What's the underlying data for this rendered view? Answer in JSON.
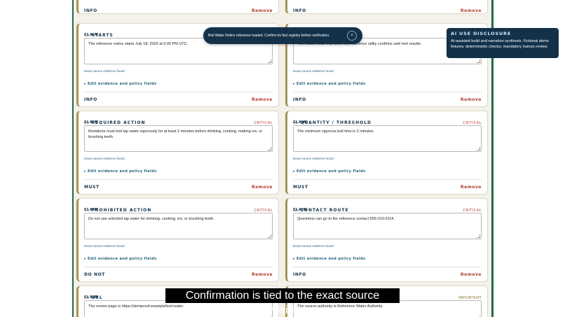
{
  "toast": {
    "message": "Boil Water Notice reference loaded. Confirm its fact registry before verification.",
    "close_label": "×"
  },
  "ai_disclosure": {
    "title": "AI USE DISCLOSURE",
    "body": "AI-assisted build and narration synthesis. Fictional demo fixtures; deterministic checks; mandatory human review."
  },
  "caption": "Confirmation is tied to the exact source revision.",
  "common": {
    "claim_label": "CLAIM",
    "evidence_text": "Exact source evidence found",
    "edit_label": "▸ Edit evidence and policy fields",
    "remove_label": "Remove"
  },
  "top_cards": [
    {
      "tag": "INFO"
    },
    {
      "tag": "INFO"
    }
  ],
  "cards": [
    {
      "number": "03",
      "title": "STARTS",
      "severity": "",
      "text": "The reference notice starts July 18, 2026 at 6:00 PM UTC.",
      "tag": "INFO"
    },
    {
      "number": "04",
      "title": "",
      "severity": "",
      "text": "The notice ends only when the reference utility confirms safe test results.",
      "tag": "INFO"
    },
    {
      "number": "05",
      "title": "REQUIRED ACTION",
      "severity": "CRITICAL",
      "text": "Residents must boil tap water vigorously for at least 2 minutes before drinking, cooking, making ice, or brushing teeth.",
      "tag": "MUST"
    },
    {
      "number": "06",
      "title": "QUANTITY / THRESHOLD",
      "severity": "CRITICAL",
      "text": "The minimum vigorous boil time is 2 minutes.",
      "tag": "MUST"
    },
    {
      "number": "07",
      "title": "PROHIBITED ACTION",
      "severity": "CRITICAL",
      "text": "Do not use unboiled tap water for drinking, cooking, ice, or brushing teeth.",
      "tag": "DO NOT"
    },
    {
      "number": "08",
      "title": "CONTACT ROUTE",
      "severity": "CRITICAL",
      "text": "Questions can go to the reference contact 555-010-0114.",
      "tag": "INFO"
    }
  ],
  "bottom_cards": [
    {
      "number": "09",
      "title": "URL",
      "severity": "",
      "text": "The review page is https://alertproof.example/boil-water."
    },
    {
      "number": "10",
      "title": "",
      "severity": "IMPORTANT",
      "text": "The source authority is Reference Water Authority."
    }
  ],
  "colors": {
    "frame": "#1f6b4c",
    "navy": "#13324a",
    "critical": "#b03a2e",
    "card_accent": "#a9925a"
  }
}
